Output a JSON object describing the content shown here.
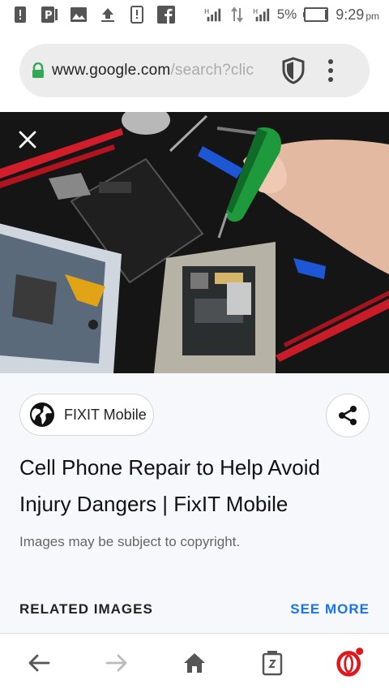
{
  "status_bar": {
    "icons": [
      "alert-icon",
      "parking-icon",
      "image-icon",
      "upload-icon",
      "phone-alert-icon",
      "facebook-icon",
      "signal-h-icon",
      "data-arrows-icon",
      "signal-h-icon",
      "battery-icon"
    ],
    "battery_percent": "5%",
    "time": "9:29",
    "time_suffix": "pm"
  },
  "url_bar": {
    "domain": "www.google.com",
    "path": "/search?clic",
    "icons": [
      "lock-icon",
      "shield-icon",
      "more-vert-icon"
    ],
    "lock_color": "#34a853"
  },
  "hero": {
    "close_icon": "close-icon"
  },
  "card": {
    "source_label": "FIXIT Mobile",
    "source_icon": "globe-icon",
    "share_icon": "share-icon",
    "title_line1": "Cell Phone Repair to Help Avoid",
    "title_line2": "Injury Dangers | FixIT Mobile",
    "copyright_note": "Images may be subject to copyright.",
    "related_label": "RELATED IMAGES",
    "see_more_label": "SEE MORE",
    "accent_color": "#1a73e8"
  },
  "bottom_nav": {
    "items": [
      "back-icon",
      "forward-icon",
      "home-icon",
      "tabs-icon",
      "opera-icon"
    ],
    "brand_color": "#e0161b"
  }
}
